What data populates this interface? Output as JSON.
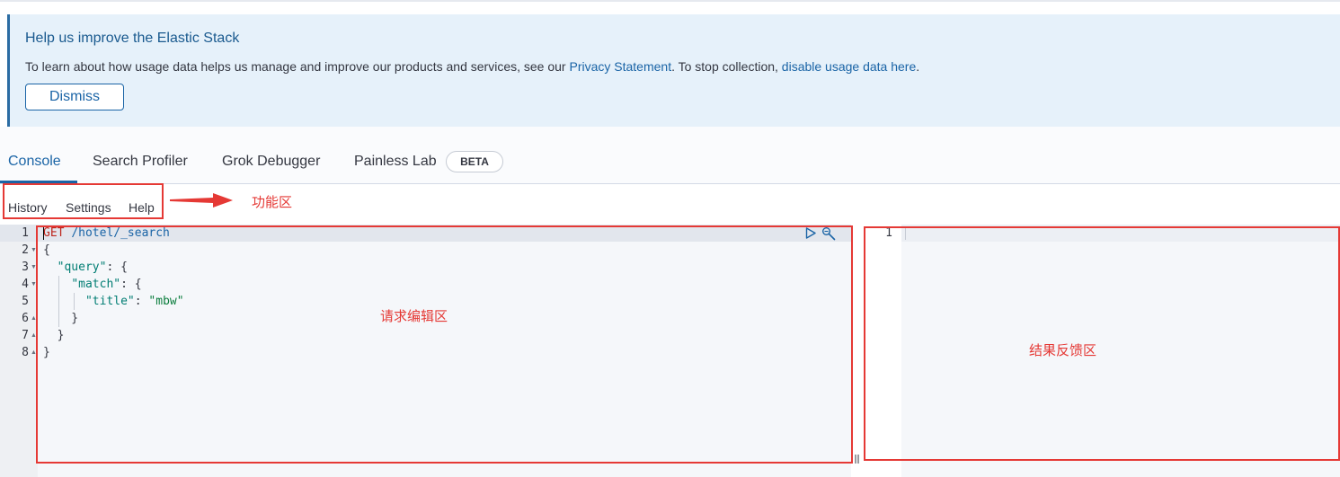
{
  "callout": {
    "title": "Help us improve the Elastic Stack",
    "body_prefix": "To learn about how usage data helps us manage and improve our products and services, see our ",
    "privacy_link": "Privacy Statement",
    "body_middle": ". To stop collection, ",
    "disable_link": "disable usage data here",
    "body_suffix": ".",
    "dismiss_label": "Dismiss"
  },
  "tabs": [
    {
      "label": "Console",
      "active": true
    },
    {
      "label": "Search Profiler",
      "active": false
    },
    {
      "label": "Grok Debugger",
      "active": false
    },
    {
      "label": "Painless Lab",
      "active": false
    }
  ],
  "beta_badge": "BETA",
  "menu": {
    "history": "History",
    "settings": "Settings",
    "help": "Help"
  },
  "annotations": {
    "function_area": "功能区",
    "request_editor": "请求编辑区",
    "result_area": "结果反馈区"
  },
  "editor": {
    "line_numbers": [
      "1",
      "2",
      "3",
      "4",
      "5",
      "6",
      "7",
      "8"
    ],
    "method": "GET",
    "path": "/hotel/_search",
    "lines": [
      "{",
      "  \"query\": {",
      "    \"match\": {",
      "      \"title\": \"mbw\"",
      "    }",
      "  }",
      "}"
    ],
    "keys": {
      "query": "\"query\"",
      "match": "\"match\"",
      "title": "\"title\""
    },
    "value": "\"mbw\""
  },
  "output": {
    "line_numbers": [
      "1"
    ]
  },
  "icons": [
    "play-icon",
    "wrench-icon",
    "splitter-grip-icon",
    "arrow-icon"
  ],
  "colors": {
    "accent": "#1a64a6",
    "annotation": "#e53935",
    "callout_bg": "#e6f1fa"
  }
}
